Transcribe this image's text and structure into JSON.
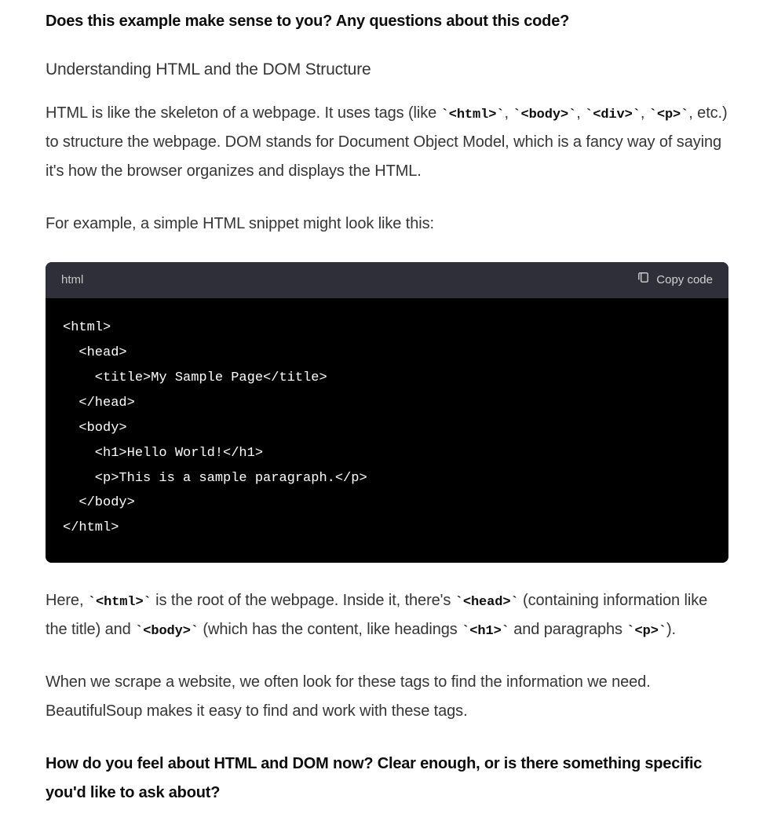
{
  "intro_question": "Does this example make sense to you? Any questions about this code?",
  "subheading": "Understanding HTML and the DOM Structure",
  "para1_prefix": "HTML is like the skeleton of a webpage. It uses tags (like ",
  "tag_html": "`<html>`",
  "comma1": ", ",
  "tag_body": "`<body>`",
  "comma2": ", ",
  "tag_div": "`<div>`",
  "comma3": ", ",
  "tag_p": "`<p>`",
  "para1_suffix": ", etc.) to structure the webpage. DOM stands for Document Object Model, which is a fancy way of saying it's how the browser organizes and displays the HTML.",
  "para2": "For example, a simple HTML snippet might look like this:",
  "code_block": {
    "language": "html",
    "copy_label": "Copy code",
    "content": "<html>\n  <head>\n    <title>My Sample Page</title>\n  </head>\n  <body>\n    <h1>Hello World!</h1>\n    <p>This is a sample paragraph.</p>\n  </body>\n</html>"
  },
  "para3_a": "Here, ",
  "tag_html2": "`<html>`",
  "para3_b": " is the root of the webpage. Inside it, there's ",
  "tag_head": "`<head>`",
  "para3_c": " (containing information like the title) and ",
  "tag_body2": "`<body>`",
  "para3_d": " (which has the content, like headings ",
  "tag_h1": "`<h1>`",
  "para3_e": " and paragraphs ",
  "tag_p2": "`<p>`",
  "para3_f": ").",
  "para4": "When we scrape a website, we often look for these tags to find the information we need. BeautifulSoup makes it easy to find and work with these tags.",
  "closing_question": "How do you feel about HTML and DOM now? Clear enough, or is there something specific you'd like to ask about?"
}
